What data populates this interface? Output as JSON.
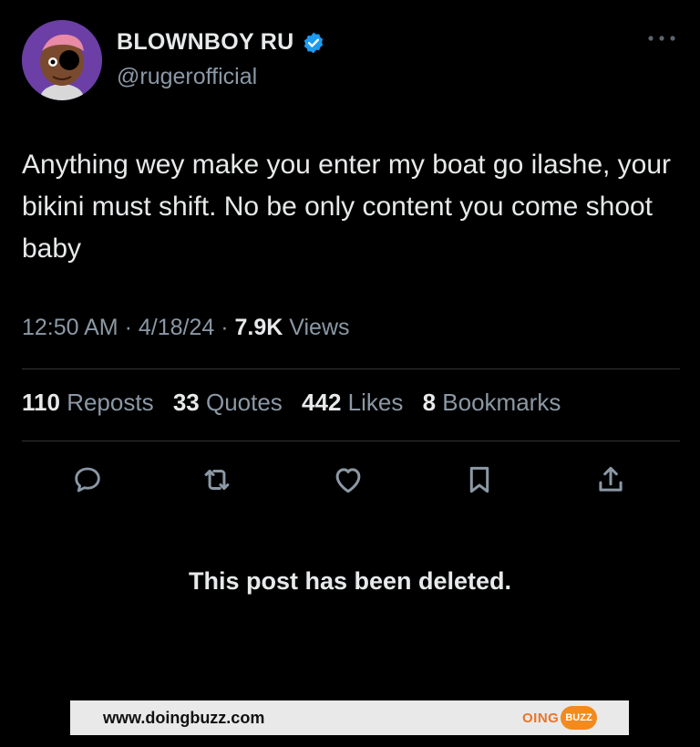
{
  "author": {
    "display_name": "BLOWNBOY RU",
    "handle": "@rugerofficial",
    "verified": true,
    "verified_color": "#1d9bf0",
    "avatar_bg": "#6b3fa6"
  },
  "tweet": {
    "text": "Anything wey make you enter my boat go ilashe, your bikini must shift. No be only content you come shoot baby"
  },
  "meta": {
    "time": "12:50 AM",
    "sep1": " · ",
    "date": "4/18/24",
    "sep2": " · ",
    "views_count": "7.9K",
    "views_label": " Views"
  },
  "stats": [
    {
      "count": "110",
      "label": "Reposts"
    },
    {
      "count": "33",
      "label": "Quotes"
    },
    {
      "count": "442",
      "label": "Likes"
    },
    {
      "count": "8",
      "label": "Bookmarks"
    }
  ],
  "actions": [
    {
      "icon": "reply-icon"
    },
    {
      "icon": "repost-icon"
    },
    {
      "icon": "like-icon"
    },
    {
      "icon": "bookmark-icon"
    },
    {
      "icon": "share-icon"
    }
  ],
  "notice": "This post has been deleted.",
  "watermark": {
    "url": "www.doingbuzz.com",
    "logo_part1": "OING",
    "logo_part2": "BUZZ"
  }
}
